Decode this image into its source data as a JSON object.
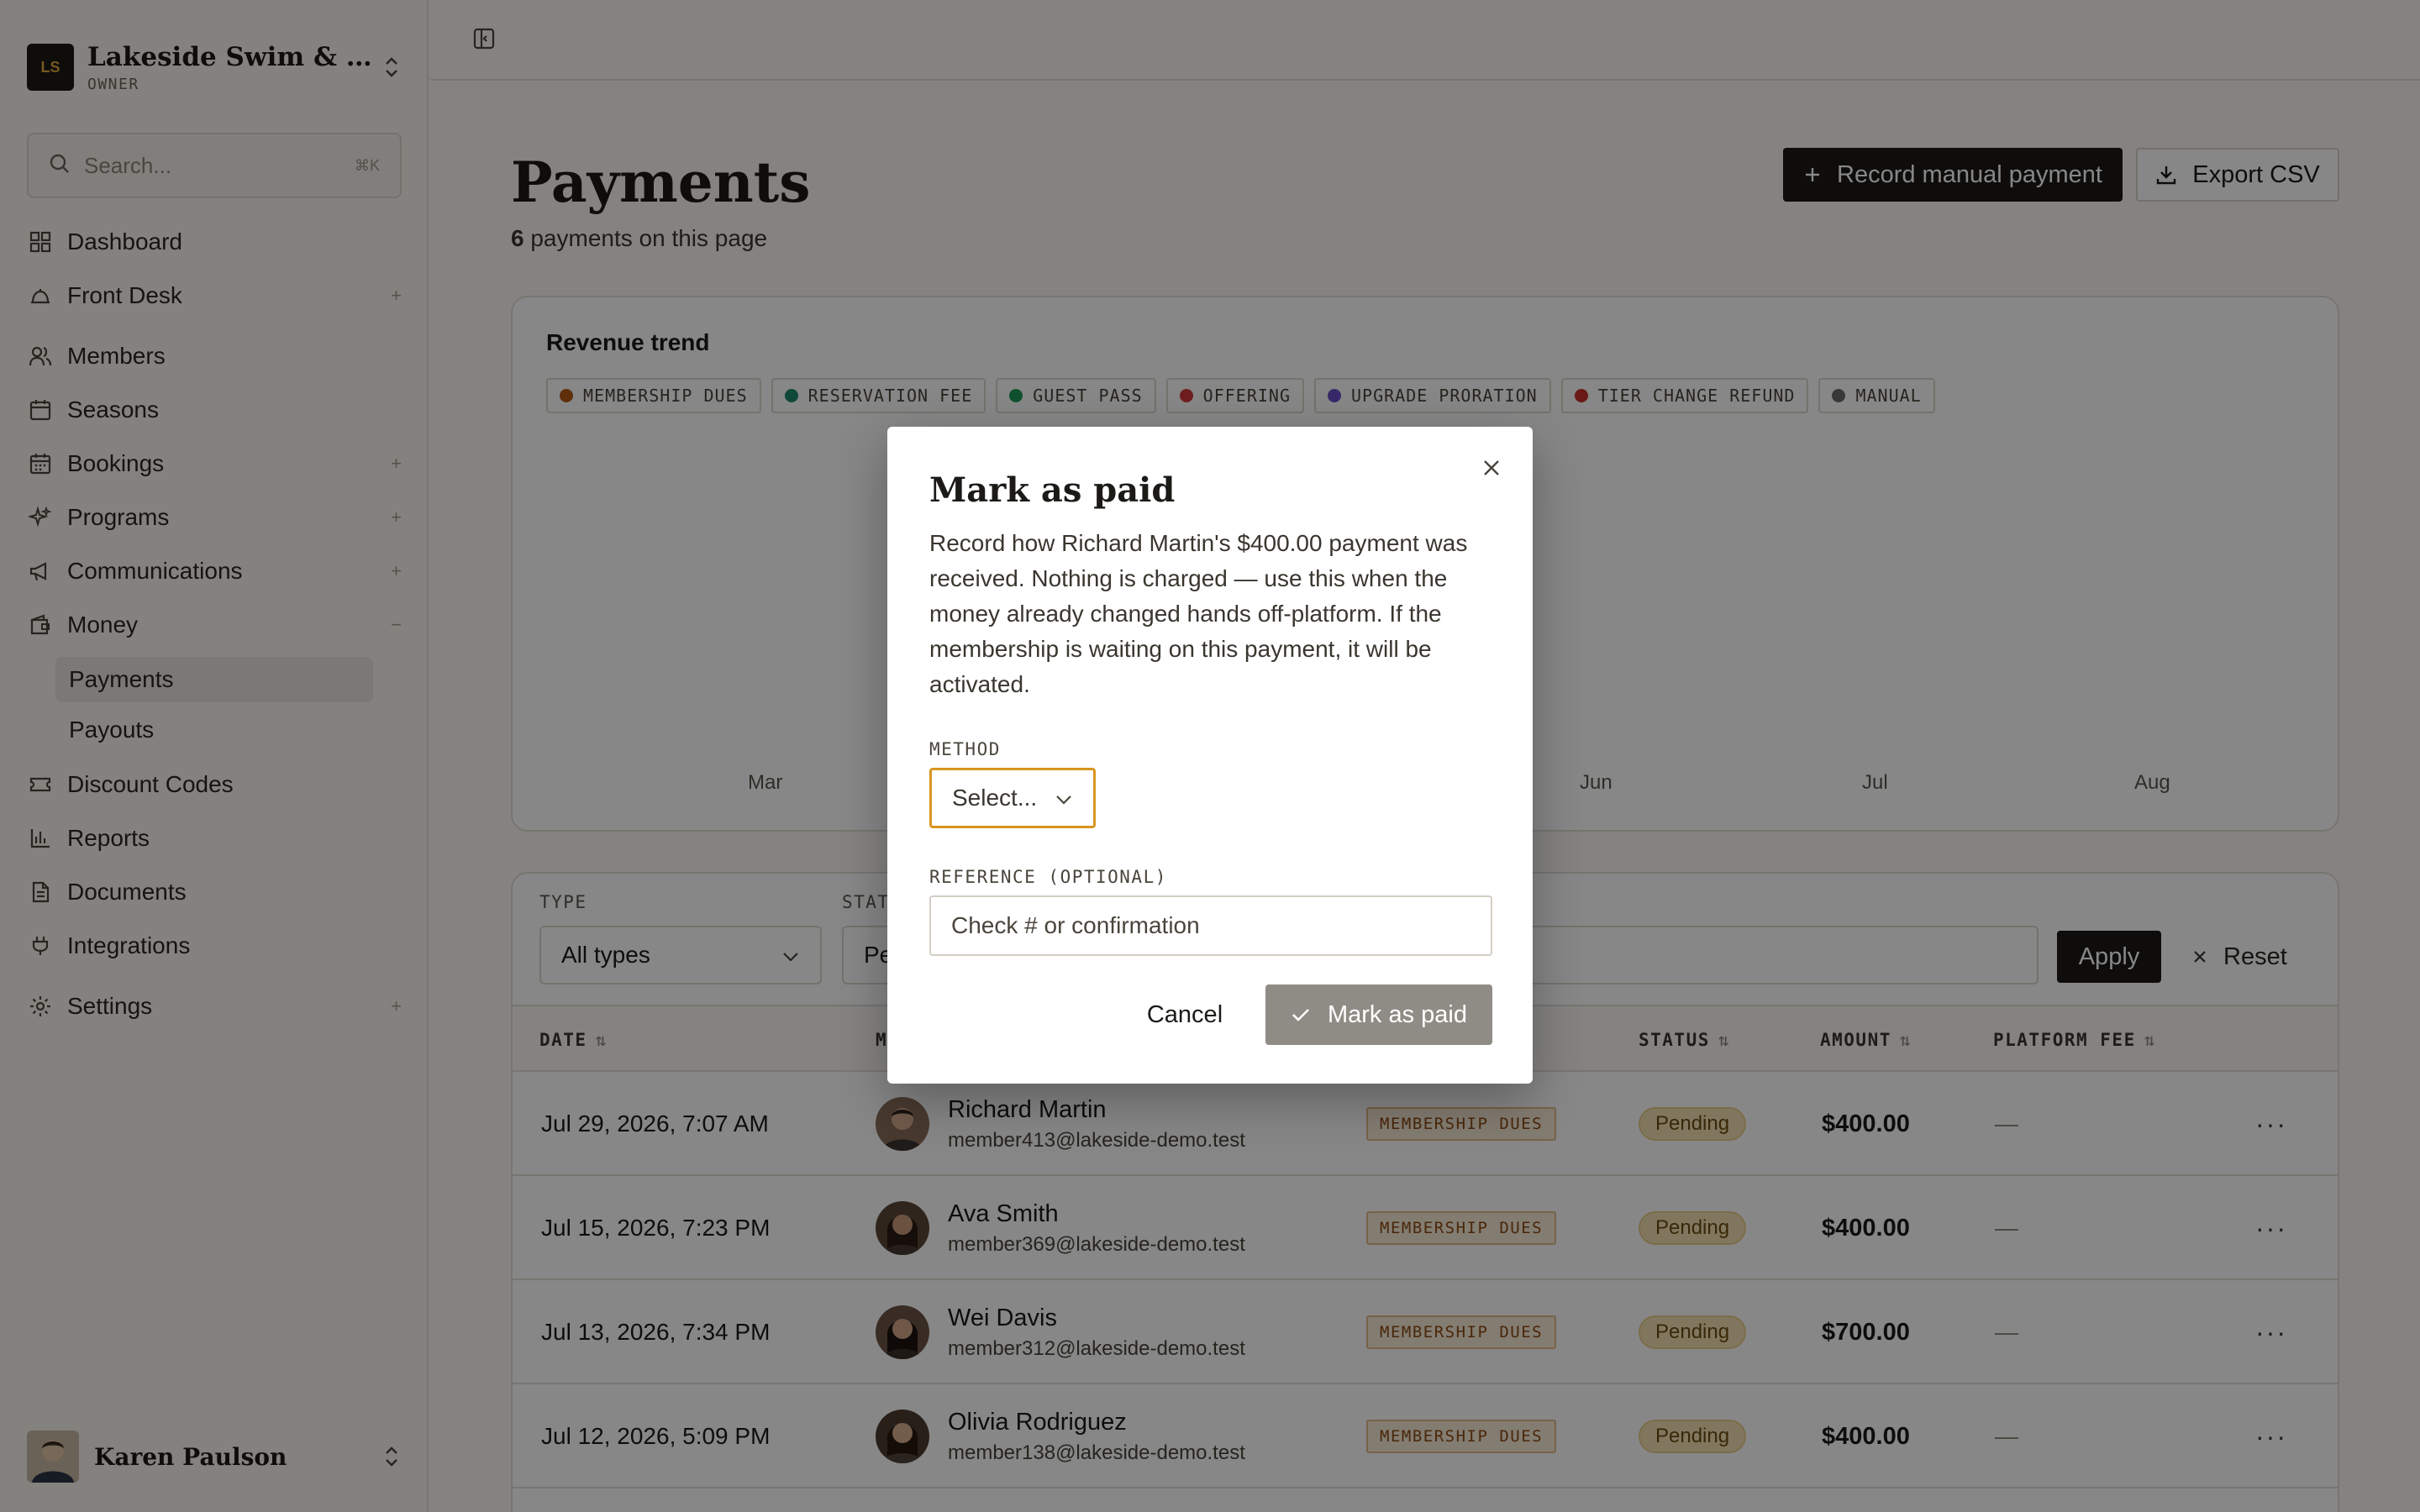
{
  "org": {
    "initials": "LS",
    "name": "Lakeside Swim & Tennis Club",
    "role": "OWNER"
  },
  "search": {
    "placeholder": "Search...",
    "shortcut": "⌘K"
  },
  "nav": {
    "items": [
      {
        "label": "Dashboard"
      },
      {
        "label": "Front Desk"
      },
      {
        "label": "Members"
      },
      {
        "label": "Seasons"
      },
      {
        "label": "Bookings"
      },
      {
        "label": "Programs"
      },
      {
        "label": "Communications"
      },
      {
        "label": "Money"
      },
      {
        "label": "Discount Codes"
      },
      {
        "label": "Reports"
      },
      {
        "label": "Documents"
      },
      {
        "label": "Integrations"
      },
      {
        "label": "Settings"
      }
    ],
    "money_sub": [
      {
        "label": "Payments"
      },
      {
        "label": "Payouts"
      }
    ]
  },
  "user": {
    "name": "Karen Paulson"
  },
  "page": {
    "title": "Payments",
    "count": "6",
    "count_suffix": " payments on this page",
    "record_button": "Record manual payment",
    "export_button": "Export CSV"
  },
  "chart": {
    "title": "Revenue trend",
    "legend": [
      {
        "label": "MEMBERSHIP DUES",
        "color": "#b45a14"
      },
      {
        "label": "RESERVATION FEE",
        "color": "#1f8a6b"
      },
      {
        "label": "GUEST PASS",
        "color": "#1e9a5a"
      },
      {
        "label": "OFFERING",
        "color": "#d03a3a"
      },
      {
        "label": "UPGRADE PRORATION",
        "color": "#6a4fc8"
      },
      {
        "label": "TIER CHANGE REFUND",
        "color": "#c8302a"
      },
      {
        "label": "MANUAL",
        "color": "#6b6b6b"
      }
    ],
    "x_labels": [
      "Mar",
      "Jun",
      "Jul",
      "Aug"
    ]
  },
  "filters": {
    "type_label": "TYPE",
    "type_value": "All types",
    "status_label": "STAT",
    "status_value": "Pe",
    "apply": "Apply",
    "reset": "Reset"
  },
  "table": {
    "headers": {
      "date": "DATE",
      "member": "M",
      "status": "STATUS",
      "amount": "AMOUNT",
      "fee": "PLATFORM FEE"
    },
    "rows": [
      {
        "date": "Jul 29, 2026, 7:07 AM",
        "name": "Richard Martin",
        "email": "member413@lakeside-demo.test",
        "type": "MEMBERSHIP DUES",
        "status": "Pending",
        "amount": "$400.00",
        "fee": "—"
      },
      {
        "date": "Jul 15, 2026, 7:23 PM",
        "name": "Ava Smith",
        "email": "member369@lakeside-demo.test",
        "type": "MEMBERSHIP DUES",
        "status": "Pending",
        "amount": "$400.00",
        "fee": "—"
      },
      {
        "date": "Jul 13, 2026, 7:34 PM",
        "name": "Wei Davis",
        "email": "member312@lakeside-demo.test",
        "type": "MEMBERSHIP DUES",
        "status": "Pending",
        "amount": "$700.00",
        "fee": "—"
      },
      {
        "date": "Jul 12, 2026, 5:09 PM",
        "name": "Olivia Rodriguez",
        "email": "member138@lakeside-demo.test",
        "type": "MEMBERSHIP DUES",
        "status": "Pending",
        "amount": "$400.00",
        "fee": "—"
      }
    ]
  },
  "modal": {
    "title": "Mark as paid",
    "description": "Record how Richard Martin's $400.00 payment was received. Nothing is charged — use this when the money already changed hands off-platform. If the membership is waiting on this payment, it will be activated.",
    "method_label": "METHOD",
    "method_value": "Select...",
    "reference_label": "REFERENCE (OPTIONAL)",
    "reference_placeholder": "Check # or confirmation",
    "cancel": "Cancel",
    "confirm": "Mark as paid"
  }
}
